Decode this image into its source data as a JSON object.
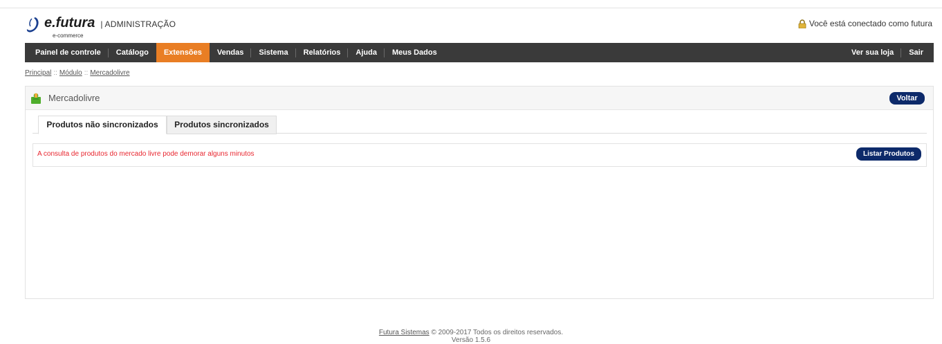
{
  "header": {
    "logo_brand": "e.futura",
    "logo_sub": "e-commerce",
    "logo_admin": "| ADMINISTRAÇÃO",
    "connected_text": "Você está conectado como futura"
  },
  "menu": {
    "items": [
      "Painel de controle",
      "Catálogo",
      "Extensões",
      "Vendas",
      "Sistema",
      "Relatórios",
      "Ajuda",
      "Meus Dados"
    ],
    "active": "Extensões",
    "right_items": [
      "Ver sua loja",
      "Sair"
    ]
  },
  "breadcrumb": [
    "Principal",
    "Módulo",
    "Mercadolivre"
  ],
  "breadcrumb_separator": "::",
  "panel": {
    "title": "Mercadolivre",
    "back_button": "Voltar",
    "tabs": [
      "Produtos não sincronizados",
      "Produtos sincronizados"
    ],
    "message": "A consulta de produtos do mercado livre pode demorar alguns minutos",
    "list_button": "Listar Produtos"
  },
  "footer": {
    "company": "Futura Sistemas",
    "rights": "© 2009-2017 Todos os direitos reservados.",
    "version": "Versão 1.5.6"
  },
  "colors": {
    "menu_bg": "#3a3a3a",
    "menu_active": "#e97e24",
    "button_bg": "#0d2a6a",
    "message_red": "#e8262f"
  }
}
